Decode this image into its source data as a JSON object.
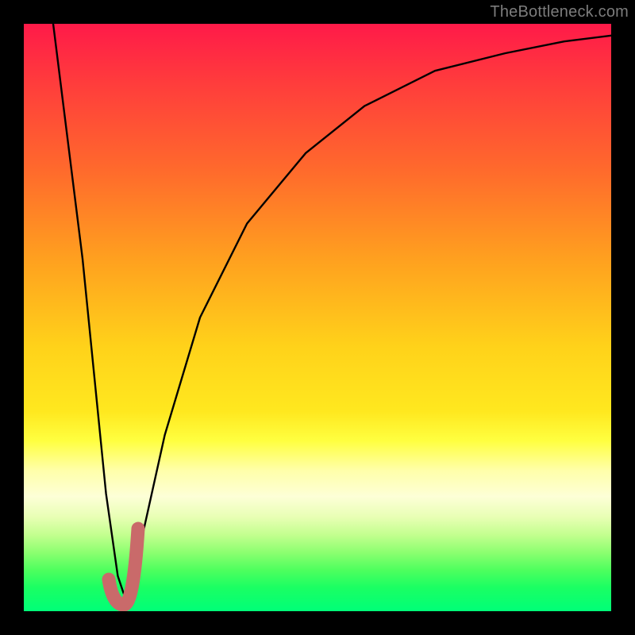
{
  "branding": {
    "watermark": "TheBottleneck.com"
  },
  "chart_data": {
    "type": "line",
    "title": "",
    "xlabel": "",
    "ylabel": "",
    "xlim": [
      0,
      100
    ],
    "ylim": [
      0,
      100
    ],
    "grid": false,
    "legend": false,
    "series": [
      {
        "name": "bottleneck-curve",
        "x": [
          5,
          10,
          14,
          16,
          17,
          18,
          20,
          24,
          30,
          38,
          48,
          58,
          70,
          82,
          92,
          100
        ],
        "values": [
          100,
          60,
          20,
          6,
          3,
          4,
          12,
          30,
          50,
          66,
          78,
          86,
          92,
          95,
          97,
          98
        ]
      }
    ],
    "annotations": [
      {
        "name": "optimal-marker",
        "shape": "check",
        "color": "#cc6666",
        "x_range": [
          14.5,
          19.5
        ],
        "y_range": [
          1,
          14
        ]
      }
    ],
    "background_gradient": {
      "top": "#ff1a49",
      "mid": "#ffe81f",
      "bottom": "#00ff78"
    }
  }
}
